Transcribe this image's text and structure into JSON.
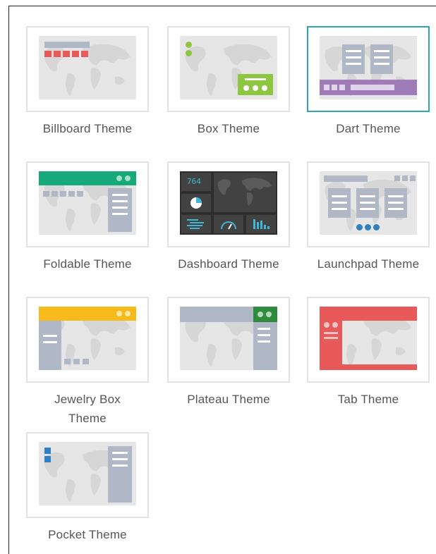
{
  "themes": [
    {
      "label": "Billboard Theme",
      "selected": false
    },
    {
      "label": "Box Theme",
      "selected": false
    },
    {
      "label": "Dart Theme",
      "selected": true
    },
    {
      "label": "Foldable Theme",
      "selected": false
    },
    {
      "label": "Dashboard Theme",
      "selected": false
    },
    {
      "label": "Launchpad Theme",
      "selected": false
    },
    {
      "label": "Jewelry Box\nTheme",
      "selected": false
    },
    {
      "label": "Plateau Theme",
      "selected": false
    },
    {
      "label": "Tab Theme",
      "selected": false
    },
    {
      "label": "Pocket Theme",
      "selected": false
    }
  ],
  "dashboard_widget_value": "764",
  "colors": {
    "selection_border": "#2aa6b8",
    "billboard_accent": "#e85a5a",
    "box_accent": "#8dc63f",
    "dart_accent": "#9f7cb8",
    "foldable_accent": "#16a97a",
    "dashboard_bg": "#3a3a3a",
    "launchpad_accent": "#2f7fc1",
    "jewelry_accent": "#f6bb1a",
    "plateau_accent": "#2e8b3e",
    "tab_accent": "#e85a5a",
    "pocket_accent": "#2d7fc6"
  }
}
